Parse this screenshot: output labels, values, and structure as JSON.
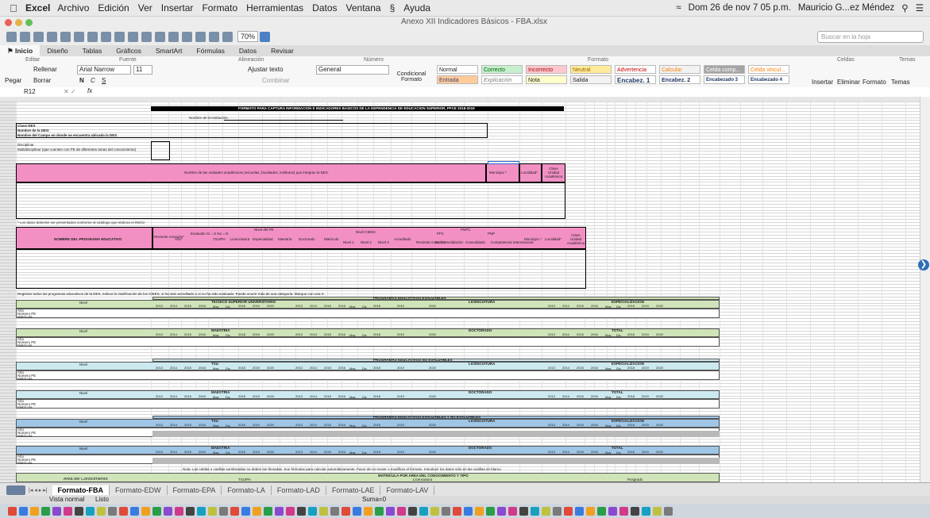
{
  "menubar": {
    "app": "Excel",
    "items": [
      "Archivo",
      "Edición",
      "Ver",
      "Insertar",
      "Formato",
      "Herramientas",
      "Datos",
      "Ventana",
      "Ayuda"
    ],
    "clock": "Dom 26 de nov 7 05 p.m.",
    "user": "Mauricio G...ez Méndez"
  },
  "window": {
    "title": "Anexo XII Indicadores Básicos - FBA.xlsx"
  },
  "toolbar": {
    "zoom": "70%",
    "search_placeholder": "Buscar en la hoja"
  },
  "ribbon_tabs": [
    "Inicio",
    "Diseño",
    "Tablas",
    "Gráficos",
    "SmartArt",
    "Fórmulas",
    "Datos",
    "Revisar"
  ],
  "ribbon": {
    "groups": {
      "editar": "Editar",
      "fuente": "Fuente",
      "alineacion": "Alineación",
      "numero": "Número",
      "formato": "Formato",
      "celdas": "Celdas",
      "temas": "Temas"
    },
    "rellenar": "Rellenar",
    "borrar": "Borrar",
    "pegar": "Pegar",
    "font_name": "Arial Narrow",
    "font_size": "11",
    "ajustar": "Ajustar texto",
    "combinar": "Combinar",
    "number_format": "General",
    "cond_format": "Condicional Formato",
    "styles": [
      "Normal",
      "Correcto",
      "Incorrecto",
      "Neutral",
      "Advertencia",
      "Calcular",
      "Celda comp...",
      "Celda vincul...",
      "Entrada",
      "Explicación",
      "Nota",
      "Salida",
      "Encabez. 1",
      "Encabez. 2",
      "Encabezado 3",
      "Encabezado 4"
    ],
    "insertar": "Insertar",
    "eliminar": "Eliminar",
    "formato_btn": "Formato",
    "temas_btn": "Temas"
  },
  "formula_bar": {
    "cell_ref": "R12",
    "fx": "fx",
    "content": ""
  },
  "sheet": {
    "title": "FORMATO PARA CAPTURA INFORMACION E INDICADORES BASICOS DE LA DEPENDENCIA DE EDUCACION SUPERIOR, PFCE 2018-2019",
    "nombre_institucion": "Nombre de la Institución:",
    "clave_des": "Clave DES",
    "nombre_des": "Nombre de la DES:",
    "nombre_campo": "Nombre del Campo en donde se encuentra ubicada la DES",
    "disciplinar": "Disciplinar",
    "multidisciplinar": "Multidisciplinar (que cuenten con PE de diferentes áreas del conocimiento)",
    "unidades_hdr": "Nombre de las unidades académicas (escuelas, facultades, institutos) que integran la DES.",
    "municipio": "Municipio *",
    "localidad": "Localidad*",
    "clave_ua": "Clave Unidad Académica",
    "nota_catalogo": "* Los datos deberán ser presentados conforme al catálogo que elabora el INEGI",
    "nombre_programa": "NOMBRE DEL PROGRAMA EDUCATIVO",
    "reciente": "Reciente creación*",
    "anio": "Año*",
    "evaluado": "Evaluado Si = S No = N",
    "nivel_pe": "Nivel del PE",
    "tsu": "TSU/PA",
    "licenciatura": "Licenciatura",
    "especialidad": "Especialidad",
    "maestria": "Maestría",
    "doctorado": "Doctorado",
    "matricula": "Matricula",
    "nivel_ciees": "Nivel CIEES",
    "nivel1": "Nivel 1",
    "nivel2": "Nivel 2",
    "nivel3": "Nivel 3",
    "acreditado": "Acreditado",
    "pnpc": "PNPC",
    "pfc": "PFC",
    "pnp": "PNP",
    "en_consolidacion": "En Consolidación",
    "consolidado": "Consolidado",
    "competencia": "Competencia Internacional",
    "nota_registrar": "Registrar todos los programas educativos de la DES, indicar la clasificación de los CIEES, si ha sido acreditado o si no ha sido evaluado. Puede ocurrir más de una categoría. Marque con una X",
    "sec_evaluables": "PROGRAMAS EDUCATIVOS EVALUABLES",
    "sec_no_evaluables": "PROGRAMAS EDUCATIVOS NO EVALUABLES",
    "sec_ambos": "PROGRAMAS EDUCATIVOS EVALUABLES Y NO EVALUABLES",
    "sec_matricula": "MATRICULA POR AREA DEL CONOCIMIENTO Y TIPO",
    "tsu_universitario": "TECNICO SUPERIOR UNIVERSITARIO",
    "tsu_short": "TSU",
    "lic_short": "LICENCIATURA",
    "especializacion": "ESPECIALIZACION",
    "maestria_cap": "MAESTRIA",
    "doctorado_cap": "DOCTORADO",
    "total": "TOTAL",
    "nivel": "Nivel",
    "anio_lbl": "Año",
    "numero_pe": "Número PE",
    "matricula_lbl": "Matrícula",
    "years": [
      "2013",
      "2014",
      "2015",
      "2016",
      "2017",
      "2018",
      "2019",
      "2020"
    ],
    "may": "May",
    "dic": "Dic",
    "nota_celdas": "Nota: Las celdas o casillas sombreadas no deben ser llenadas. Son fórmulas para calcular automáticamente. Favor de no mover o modificar el formato. Introducir los datos sólo en las casillas en blanco",
    "area_conocimiento": "Área del Conocimiento",
    "tsu_pa": "TSU/PA",
    "posgrado": "Posgrado",
    "lic_sub": "Licenciatura"
  },
  "sheet_tabs": [
    "Formato-FBA",
    "Formato-EDW",
    "Formato-EPA",
    "Formato-LA",
    "Formato-LAD",
    "Formato-LAE",
    "Formato-LAV"
  ],
  "status": {
    "mode": "Vista normal",
    "ready": "Listo",
    "sum": "Suma=0"
  },
  "colors": {
    "pink": "#f290c4",
    "green": "#cfe4b8",
    "cyan": "#cce9ef",
    "blue": "#9fc6e6"
  }
}
